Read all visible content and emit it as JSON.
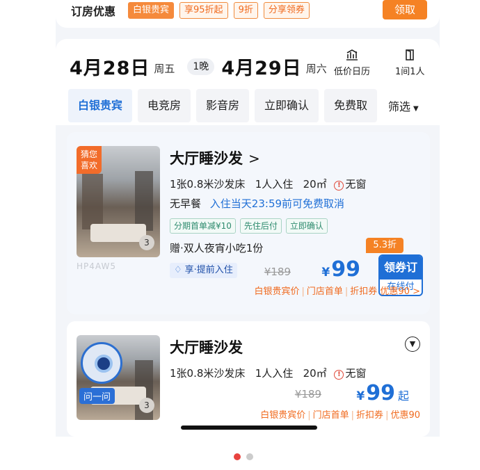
{
  "promo": {
    "title": "订房优惠",
    "tags": [
      "白银贵宾",
      "享95折起",
      "9折",
      "分享领券"
    ],
    "claim_label": "领取"
  },
  "stay": {
    "checkin_date": "4月28日",
    "checkin_weekday": "周五",
    "nights": "1晚",
    "checkout_date": "4月29日",
    "checkout_weekday": "周六",
    "calendar_label": "低价日历",
    "guests_label": "1间1人"
  },
  "filters": {
    "chips": [
      "白银贵宾",
      "电竞房",
      "影音房",
      "立即确认",
      "免费取"
    ],
    "screen_label": "筛选"
  },
  "rooms": [
    {
      "badge": "猜您\n喜欢",
      "photo_count": "3",
      "code": "HP4AW5",
      "name": "大厅睡沙发",
      "arrow": ">",
      "bed": "1张0.8米沙发床",
      "guests": "1人入住",
      "area": "20㎡",
      "window": "无窗",
      "breakfast": "无早餐",
      "cancel": "入住当天23:59前可免费取消",
      "perks": [
        "分期首单减¥10",
        "先住后付",
        "立即确认"
      ],
      "gift": "赠·双人夜宵小吃1份",
      "vip_label": "享·提前入住",
      "old_price": "¥189",
      "price_symbol": "¥",
      "price": "99",
      "offer_tag": "5.3折",
      "book_label": "领券订",
      "pay_label": "在线付",
      "discounts": [
        "白银贵宾价",
        "门店首单",
        "折扣券",
        "优惠90 >"
      ]
    },
    {
      "ask_label": "问一问",
      "photo_count": "3",
      "name": "大厅睡沙发",
      "bed": "1张0.8米沙发床",
      "guests": "1人入住",
      "area": "20㎡",
      "window": "无窗",
      "old_price": "¥189",
      "price_symbol": "¥",
      "price": "99",
      "price_suffix": "起",
      "discounts": [
        "白银贵宾价",
        "门店首单",
        "折扣券",
        "优惠90"
      ]
    }
  ],
  "pager": {
    "current": 1,
    "total": 2
  },
  "colors": {
    "accent_orange": "#f58224",
    "primary_blue": "#1f6fd6",
    "badge_green": "#2e8b6e"
  }
}
